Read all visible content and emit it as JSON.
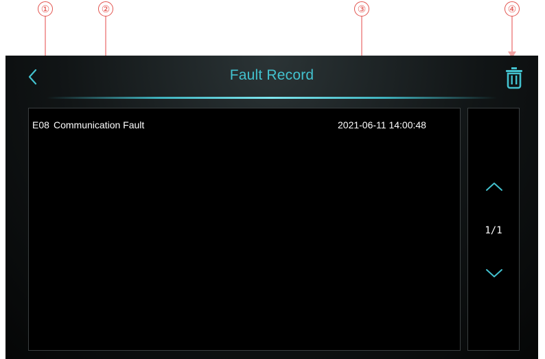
{
  "callouts": [
    "①",
    "②",
    "③",
    "④"
  ],
  "header": {
    "title": "Fault Record"
  },
  "records": [
    {
      "code": "E08",
      "name": "Communication Fault",
      "time": "2021-06-11 14:00:48"
    }
  ],
  "pager": {
    "indicator": "1/1"
  },
  "icons": {
    "back": "chevron-left-icon",
    "delete": "trash-icon",
    "page_up": "chevron-up-icon",
    "page_down": "chevron-down-icon"
  },
  "colors": {
    "accent": "#43c2cf",
    "callout": "#e2524d",
    "callout_line": "#f2a3a3",
    "background": "#000000",
    "text": "#ffffff"
  }
}
